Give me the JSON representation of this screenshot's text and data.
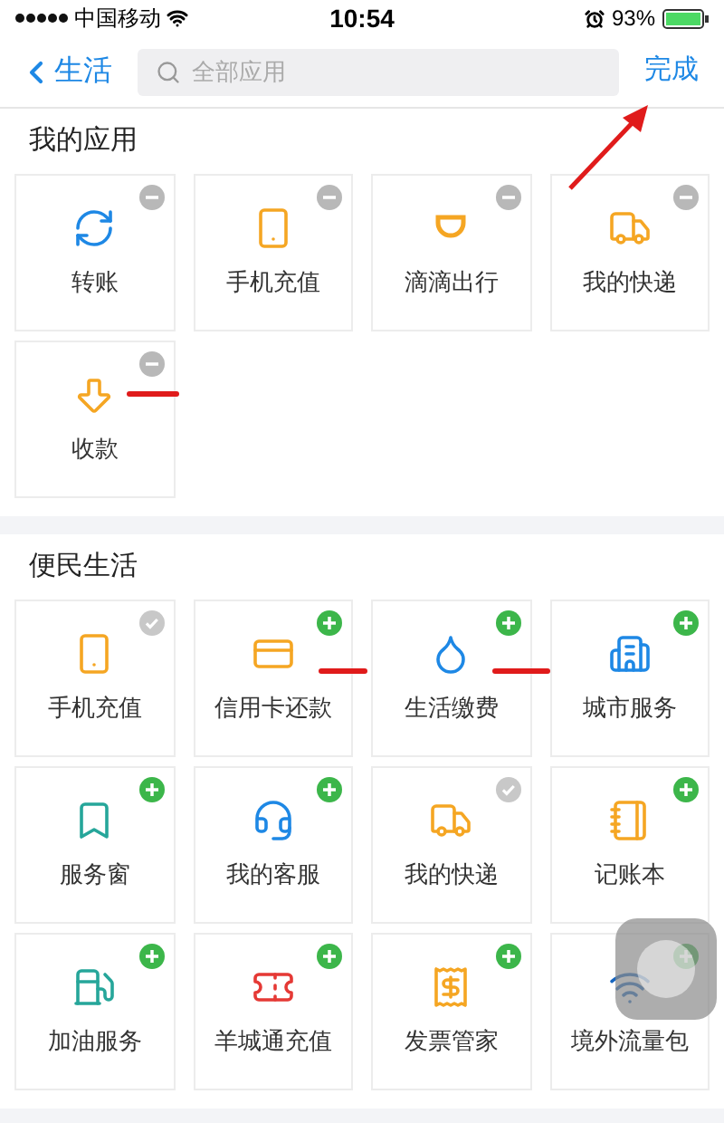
{
  "status_bar": {
    "carrier": "中国移动",
    "time": "10:54",
    "battery": "93%"
  },
  "nav": {
    "back": "生活",
    "search": {
      "placeholder": "全部应用"
    },
    "done": "完成"
  },
  "sections": [
    {
      "title": "我的应用",
      "apps": [
        {
          "label": "转账",
          "removable": true
        },
        {
          "label": "手机充值",
          "removable": true
        },
        {
          "label": "滴滴出行",
          "removable": true
        },
        {
          "label": "我的快递",
          "removable": true
        },
        {
          "label": "收款",
          "removable": true
        }
      ]
    },
    {
      "title": "便民生活",
      "apps": [
        {
          "label": "手机充值",
          "added": true
        },
        {
          "label": "信用卡还款",
          "added": false
        },
        {
          "label": "生活缴费",
          "added": false
        },
        {
          "label": "城市服务",
          "added": false
        },
        {
          "label": "服务窗",
          "added": false
        },
        {
          "label": "我的客服",
          "added": false
        },
        {
          "label": "我的快递",
          "added": true
        },
        {
          "label": "记账本",
          "added": false
        },
        {
          "label": "加油服务",
          "added": false
        },
        {
          "label": "羊城通充值",
          "added": false
        },
        {
          "label": "发票管家",
          "added": false
        },
        {
          "label": "境外流量包",
          "added": false
        }
      ]
    }
  ]
}
